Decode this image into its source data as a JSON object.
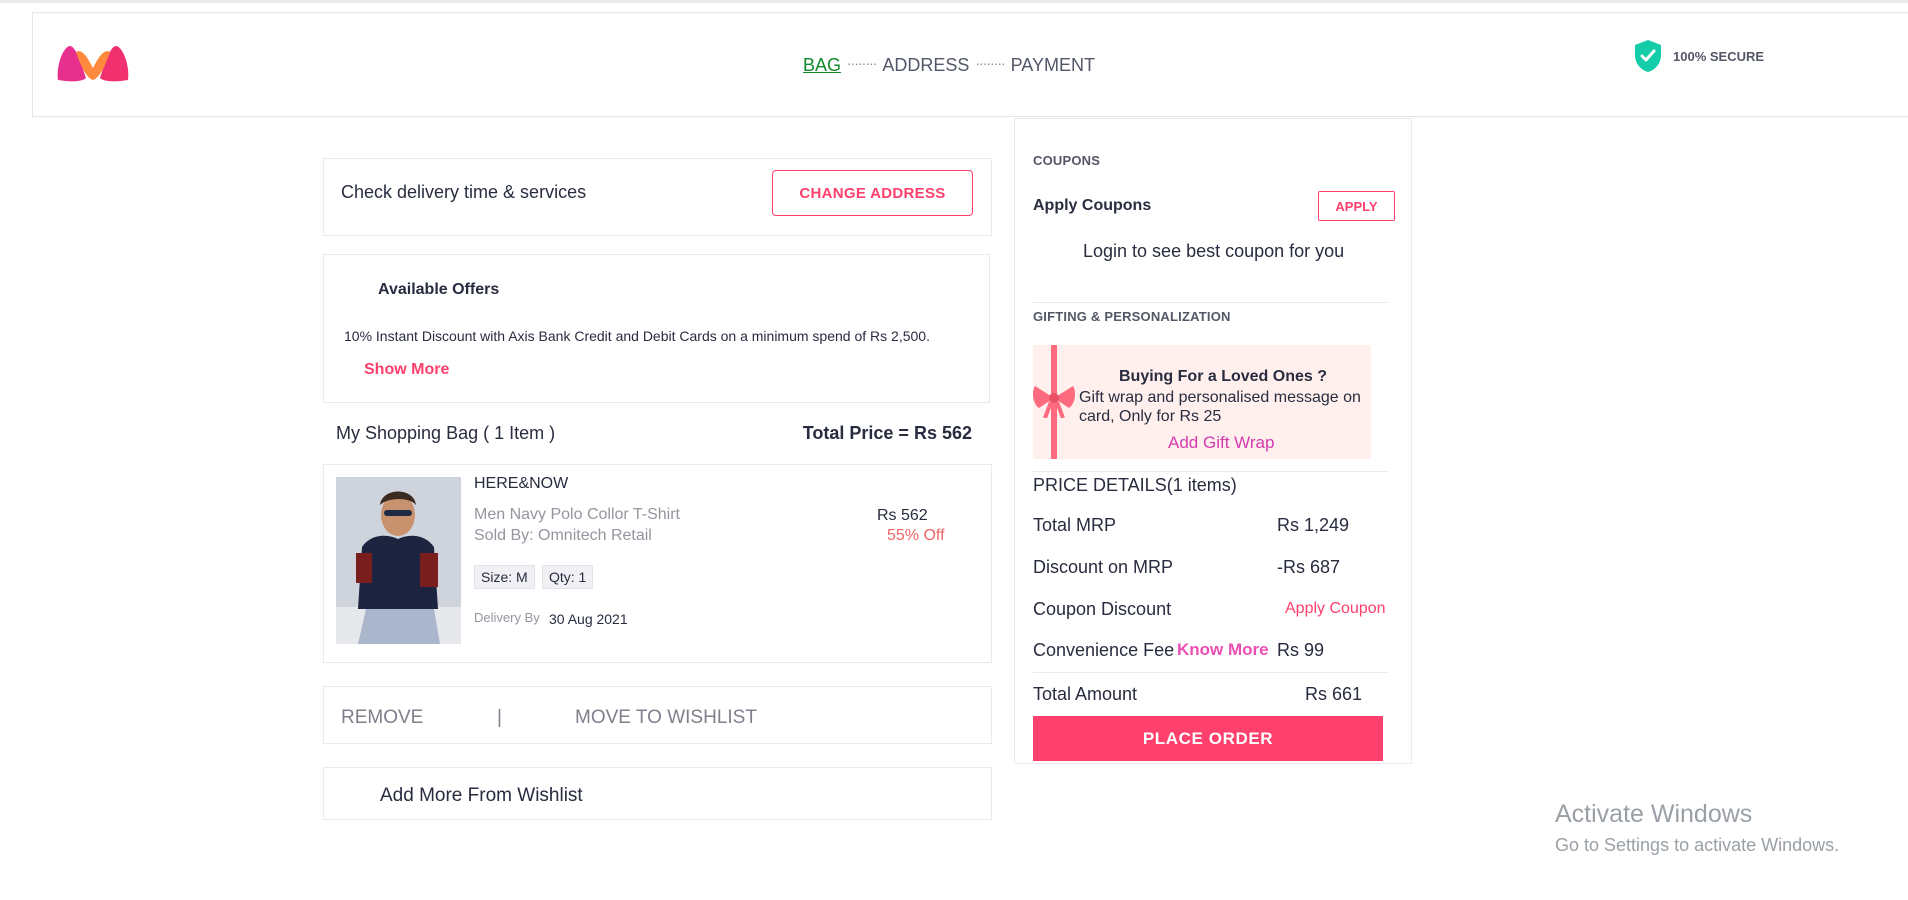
{
  "header": {
    "steps": {
      "bag": "BAG",
      "address": "ADDRESS",
      "payment": "PAYMENT",
      "dots": "········"
    },
    "secure_label": "100% SECURE"
  },
  "delivery": {
    "text": "Check delivery time & services",
    "button": "CHANGE ADDRESS"
  },
  "offers": {
    "title": "Available Offers",
    "text": "10% Instant Discount with Axis Bank Credit and Debit Cards on a minimum spend of Rs 2,500.",
    "show_more": "Show More"
  },
  "bag": {
    "title": "My Shopping Bag ( 1 Item )",
    "total": "Total Price = Rs 562",
    "item": {
      "brand": "HERE&NOW",
      "name": "Men Navy Polo Collor T-Shirt",
      "seller": "Sold By: Omnitech Retail",
      "price": "Rs 562",
      "discount": "55% Off",
      "size": "Size: M",
      "qty": "Qty: 1",
      "delivery_label": "Delivery By",
      "delivery_date": "30 Aug 2021"
    },
    "actions": {
      "remove": "REMOVE",
      "separator": "|",
      "wishlist": "MOVE TO WISHLIST"
    },
    "add_more": "Add More From Wishlist"
  },
  "sidebar": {
    "coupons_title": "COUPONS",
    "apply_coupons": "Apply Coupons",
    "apply_button": "APPLY",
    "login_hint": "Login to see best coupon for you",
    "gifting_title": "GIFTING & PERSONALIZATION",
    "gift": {
      "title": "Buying For a Loved Ones ?",
      "desc": "Gift wrap and personalised message on card, Only for Rs 25",
      "link": "Add Gift Wrap"
    },
    "price_details": "PRICE DETAILS(1 items)",
    "rows": {
      "total_mrp_label": "Total MRP",
      "total_mrp_value": "Rs 1,249",
      "discount_label": "Discount on MRP",
      "discount_value": "-Rs 687",
      "coupon_label": "Coupon Discount",
      "coupon_value": "Apply Coupon",
      "fee_label": "Convenience Fee",
      "fee_link": "Know More",
      "fee_value": "Rs 99",
      "total_label": "Total Amount",
      "total_value": "Rs 661"
    },
    "place_order": "PLACE ORDER"
  },
  "watermark": {
    "line1": "Activate Windows",
    "line2": "Go to Settings to activate Windows."
  },
  "colors": {
    "accent": "#ff3f6c",
    "active_step": "#0f8a2b",
    "gift_link": "#d63aaf",
    "secure": "#14cda8"
  },
  "icons": {
    "logo": "myntra-logo",
    "secure": "shield-check-icon",
    "gift": "gift-ribbon-icon"
  }
}
